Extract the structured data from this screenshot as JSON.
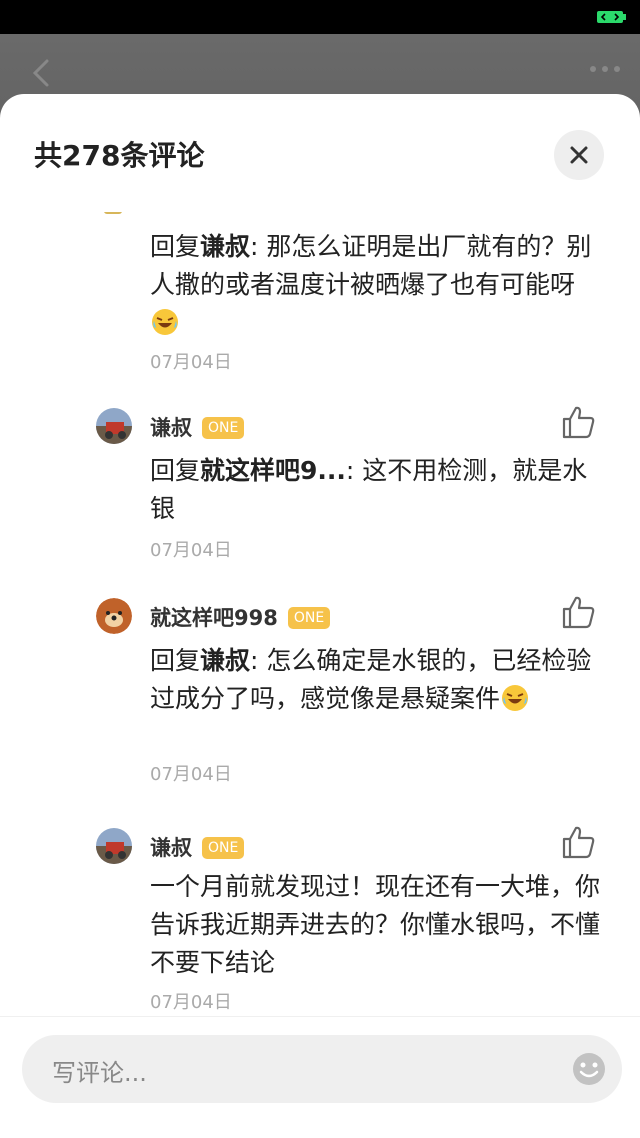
{
  "header": {
    "title": "共278条评论"
  },
  "comments": [
    {
      "reply_prefix": "回复",
      "reply_to": "谦叔",
      "text": ": 那怎么证明是出厂就有的？别人撒的或者温度计被晒爆了也有可能呀",
      "date": "07月04日",
      "emoji": "laughing-tears-emoji"
    },
    {
      "user": "谦叔",
      "badge": "ONE",
      "reply_prefix": "回复",
      "reply_to": "就这样吧9...",
      "text": ": 这不用检测，就是水银",
      "date": "07月04日"
    },
    {
      "user": "就这样吧998",
      "badge": "ONE",
      "reply_prefix": "回复",
      "reply_to": "谦叔",
      "text": ": 怎么确定是水银的，已经检验过成分了吗，感觉像是悬疑案件",
      "date": "07月04日",
      "emoji": "laughing-tears-emoji"
    },
    {
      "user": "谦叔",
      "badge": "ONE",
      "text": "一个月前就发现过！现在还有一大堆，你告诉我近期弄进去的？你懂水银吗，不懂不要下结论",
      "date": "07月04日"
    }
  ],
  "footer": {
    "placeholder": "写评论..."
  },
  "colors": {
    "badge": "#f6c24a",
    "battery": "#2bd96b"
  }
}
